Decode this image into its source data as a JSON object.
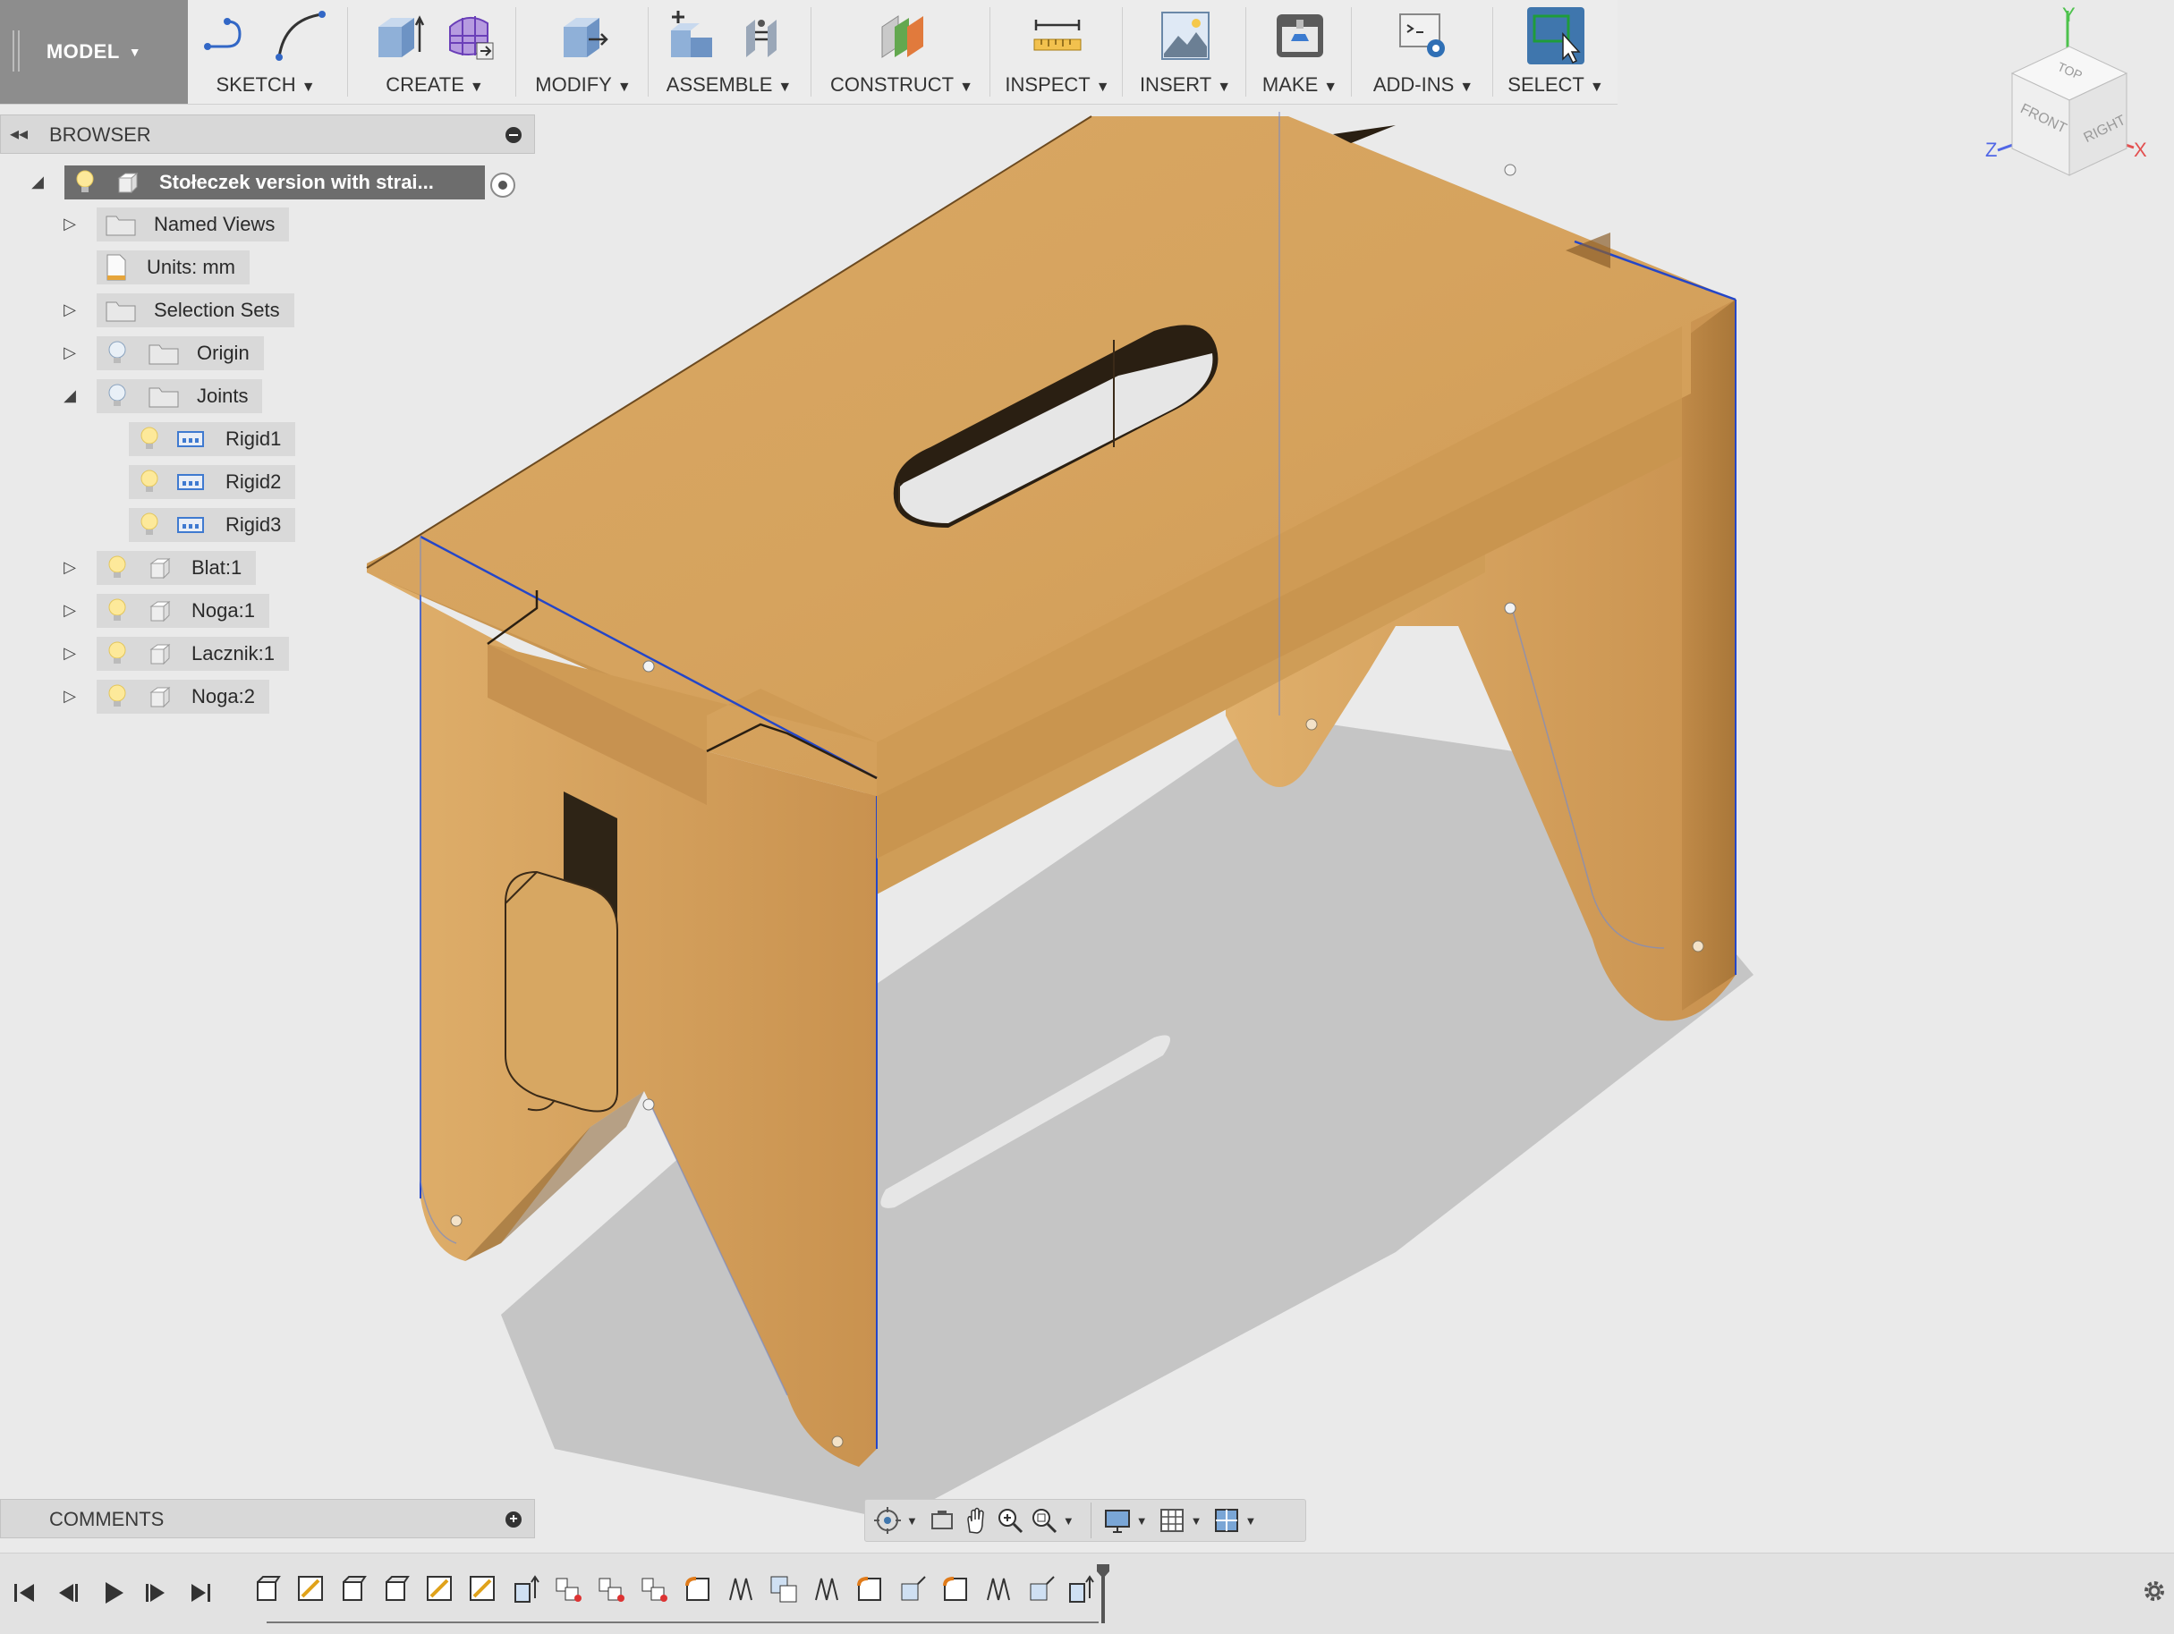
{
  "workspace": {
    "label": "MODEL"
  },
  "toolbar": {
    "groups": [
      {
        "label": "SKETCH",
        "icons": [
          "sketch-line-icon",
          "sketch-arc-icon"
        ]
      },
      {
        "label": "CREATE",
        "icons": [
          "extrude-icon",
          "form-icon"
        ]
      },
      {
        "label": "MODIFY",
        "icons": [
          "press-pull-icon"
        ]
      },
      {
        "label": "ASSEMBLE",
        "icons": [
          "new-component-icon",
          "joint-icon"
        ]
      },
      {
        "label": "CONSTRUCT",
        "icons": [
          "offset-plane-icon"
        ]
      },
      {
        "label": "INSPECT",
        "icons": [
          "measure-icon"
        ]
      },
      {
        "label": "INSERT",
        "icons": [
          "insert-image-icon"
        ]
      },
      {
        "label": "MAKE",
        "icons": [
          "3d-print-icon"
        ]
      },
      {
        "label": "ADD-INS",
        "icons": [
          "scripts-addins-icon"
        ]
      },
      {
        "label": "SELECT",
        "icons": [
          "select-window-icon"
        ]
      }
    ]
  },
  "viewcube": {
    "top": "TOP",
    "front": "FRONT",
    "right": "RIGHT",
    "axis_x": "X",
    "axis_y": "Y",
    "axis_z": "Z"
  },
  "browser": {
    "title": "BROWSER",
    "root": "Stołeczek version with strai...",
    "items": [
      {
        "label": "Named Views"
      },
      {
        "label": "Units: mm"
      },
      {
        "label": "Selection Sets"
      },
      {
        "label": "Origin"
      },
      {
        "label": "Joints"
      },
      {
        "label": "Rigid1"
      },
      {
        "label": "Rigid2"
      },
      {
        "label": "Rigid3"
      },
      {
        "label": "Blat:1"
      },
      {
        "label": "Noga:1"
      },
      {
        "label": "Lacznik:1"
      },
      {
        "label": "Noga:2"
      }
    ]
  },
  "comments": {
    "title": "COMMENTS"
  },
  "colors": {
    "wood": "#d9a864",
    "wood_dark": "#b7844a",
    "toolbar_bg": "#ececec",
    "select_active": "#3f76ad",
    "edge_blue": "#2446c8"
  }
}
